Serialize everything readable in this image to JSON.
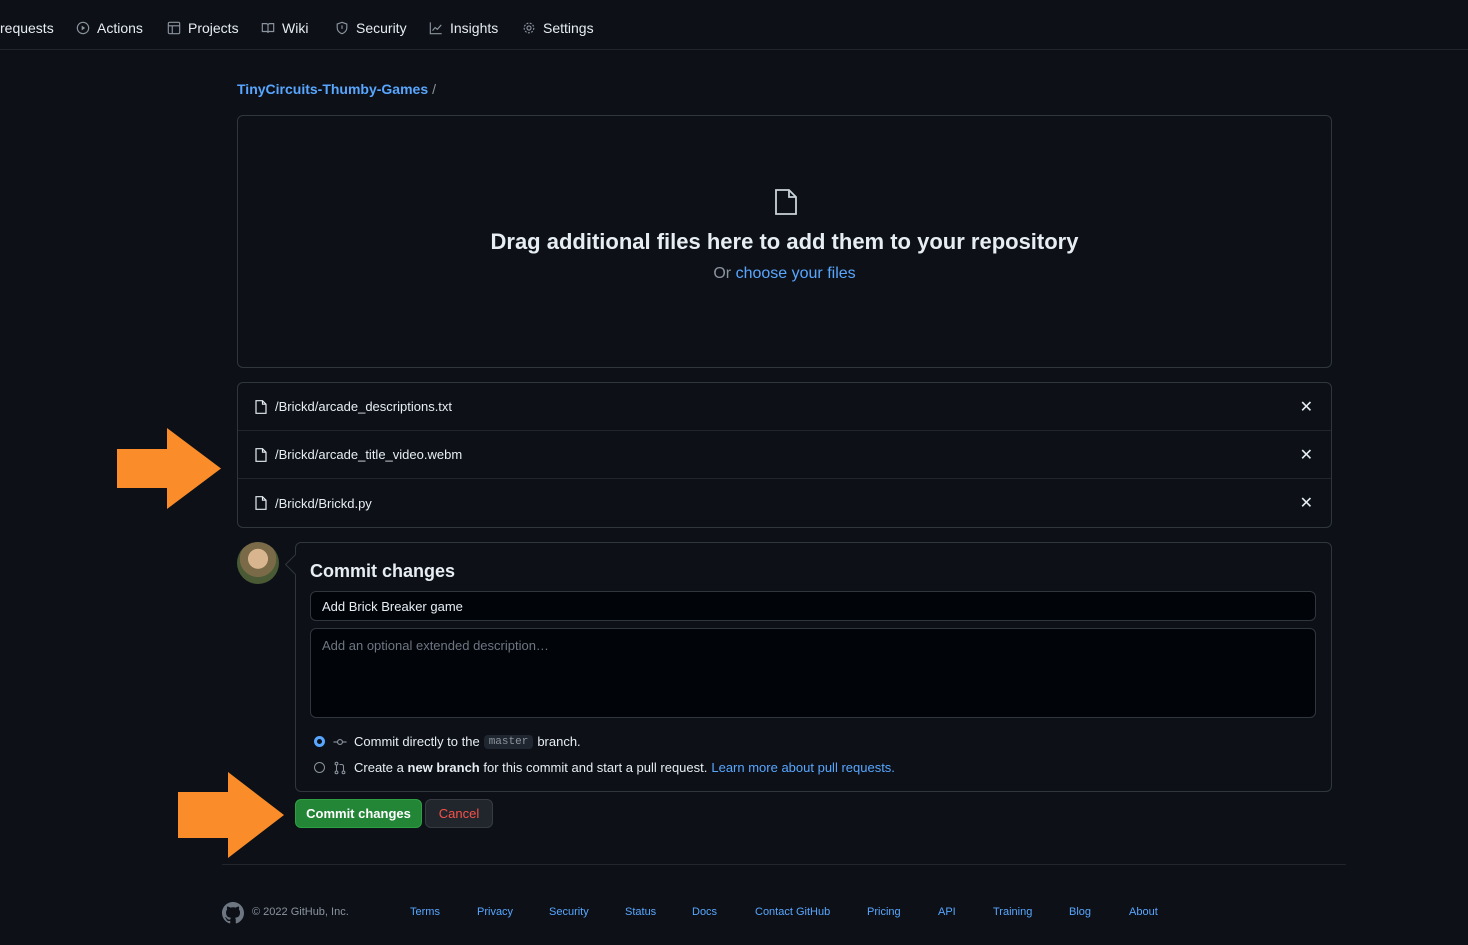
{
  "nav": {
    "items": [
      {
        "label": "requests",
        "icon": "pull-request-icon"
      },
      {
        "label": "Actions",
        "icon": "play-icon"
      },
      {
        "label": "Projects",
        "icon": "table-icon"
      },
      {
        "label": "Wiki",
        "icon": "book-icon"
      },
      {
        "label": "Security",
        "icon": "shield-icon"
      },
      {
        "label": "Insights",
        "icon": "graph-icon"
      },
      {
        "label": "Settings",
        "icon": "gear-icon"
      }
    ]
  },
  "breadcrumb": {
    "repo": "TinyCircuits-Thumby-Games",
    "separator": "/"
  },
  "dropzone": {
    "title": "Drag additional files here to add them to your repository",
    "or_text": "Or",
    "choose_link": "choose your files"
  },
  "files": [
    {
      "path": "/Brickd/arcade_descriptions.txt"
    },
    {
      "path": "/Brickd/arcade_title_video.webm"
    },
    {
      "path": "/Brickd/Brickd.py"
    }
  ],
  "commit": {
    "title": "Commit changes",
    "summary_value": "Add Brick Breaker game",
    "description_placeholder": "Add an optional extended description…",
    "option_direct_pre": "Commit directly to the",
    "option_direct_branch": "master",
    "option_direct_post": "branch.",
    "option_new_pre": "Create a",
    "option_new_bold": "new branch",
    "option_new_post": "for this commit and start a pull request.",
    "option_new_link": "Learn more about pull requests.",
    "commit_button": "Commit changes",
    "cancel_button": "Cancel"
  },
  "footer": {
    "copyright": "© 2022 GitHub, Inc.",
    "links": [
      "Terms",
      "Privacy",
      "Security",
      "Status",
      "Docs",
      "Contact GitHub",
      "Pricing",
      "API",
      "Training",
      "Blog",
      "About"
    ]
  },
  "colors": {
    "background": "#0d1117",
    "link": "#58a6ff",
    "primary_button": "#238636",
    "danger_text": "#f85149",
    "annotation_arrow": "#fb8c2a"
  }
}
